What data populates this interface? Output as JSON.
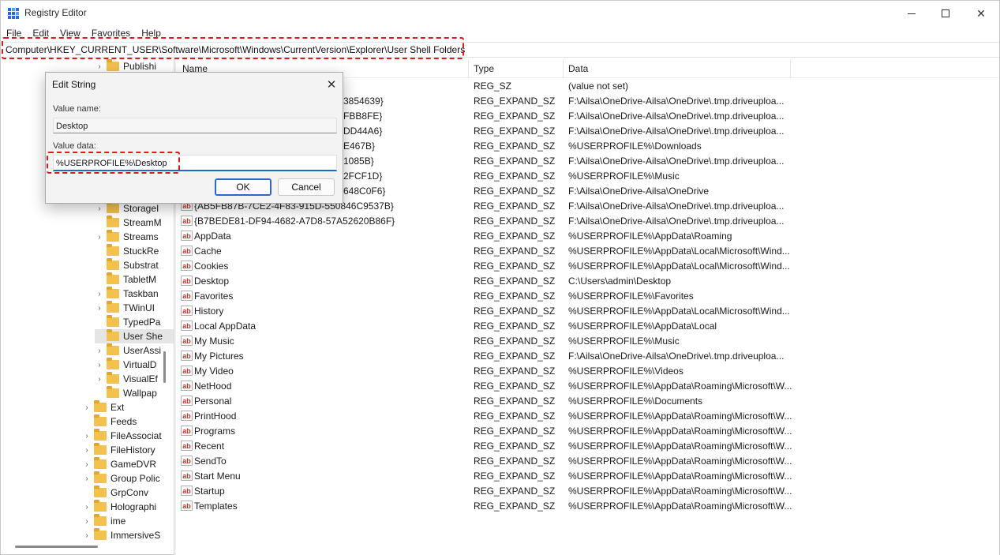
{
  "window": {
    "title": "Registry Editor",
    "controls": {
      "minimize": "minimize-icon",
      "maximize": "maximize-icon",
      "close": "close-icon"
    }
  },
  "menu": [
    "File",
    "Edit",
    "View",
    "Favorites",
    "Help"
  ],
  "address": "Computer\\HKEY_CURRENT_USER\\Software\\Microsoft\\Windows\\CurrentVersion\\Explorer\\User Shell Folders",
  "tree": {
    "items": [
      {
        "label": "Publishi",
        "expandable": true,
        "selected": false
      },
      {
        "label": "StorageI",
        "expandable": true,
        "selected": false
      },
      {
        "label": "StreamM",
        "expandable": false,
        "selected": false
      },
      {
        "label": "Streams",
        "expandable": true,
        "selected": false
      },
      {
        "label": "StuckRe",
        "expandable": false,
        "selected": false
      },
      {
        "label": "Substrat",
        "expandable": false,
        "selected": false
      },
      {
        "label": "TabletM",
        "expandable": false,
        "selected": false
      },
      {
        "label": "Taskban",
        "expandable": true,
        "selected": false
      },
      {
        "label": "TWinUI",
        "expandable": true,
        "selected": false
      },
      {
        "label": "TypedPa",
        "expandable": false,
        "selected": false
      },
      {
        "label": "User She",
        "expandable": false,
        "selected": true
      },
      {
        "label": "UserAssi",
        "expandable": true,
        "selected": false
      },
      {
        "label": "VirtualD",
        "expandable": true,
        "selected": false
      },
      {
        "label": "VisualEf",
        "expandable": true,
        "selected": false
      },
      {
        "label": "Wallpap",
        "expandable": false,
        "selected": false
      },
      {
        "label": "Ext",
        "expandable": true,
        "selected": false
      },
      {
        "label": "Feeds",
        "expandable": false,
        "selected": false
      },
      {
        "label": "FileAssociat",
        "expandable": true,
        "selected": false
      },
      {
        "label": "FileHistory",
        "expandable": true,
        "selected": false
      },
      {
        "label": "GameDVR",
        "expandable": true,
        "selected": false
      },
      {
        "label": "Group Polic",
        "expandable": true,
        "selected": false
      },
      {
        "label": "GrpConv",
        "expandable": false,
        "selected": false
      },
      {
        "label": "Holographi",
        "expandable": true,
        "selected": false
      },
      {
        "label": "ime",
        "expandable": true,
        "selected": false
      },
      {
        "label": "ImmersiveS",
        "expandable": true,
        "selected": false
      }
    ]
  },
  "list": {
    "columns": {
      "name": "Name",
      "type": "Type",
      "data": "Data"
    },
    "rows": [
      {
        "name": "",
        "type": "REG_SZ",
        "data": "(value not set)"
      },
      {
        "name": "3854639}",
        "type": "REG_EXPAND_SZ",
        "data": "F:\\Ailsa\\OneDrive-Ailsa\\OneDrive\\.tmp.driveuploa..."
      },
      {
        "name": "FBB8FE}",
        "type": "REG_EXPAND_SZ",
        "data": "F:\\Ailsa\\OneDrive-Ailsa\\OneDrive\\.tmp.driveuploa..."
      },
      {
        "name": "DD44A6}",
        "type": "REG_EXPAND_SZ",
        "data": "F:\\Ailsa\\OneDrive-Ailsa\\OneDrive\\.tmp.driveuploa..."
      },
      {
        "name": "E467B}",
        "type": "REG_EXPAND_SZ",
        "data": "%USERPROFILE%\\Downloads"
      },
      {
        "name": "1085B}",
        "type": "REG_EXPAND_SZ",
        "data": "F:\\Ailsa\\OneDrive-Ailsa\\OneDrive\\.tmp.driveuploa..."
      },
      {
        "name": "2FCF1D}",
        "type": "REG_EXPAND_SZ",
        "data": "%USERPROFILE%\\Music"
      },
      {
        "name": "648C0F6}",
        "type": "REG_EXPAND_SZ",
        "data": "F:\\Ailsa\\OneDrive-Ailsa\\OneDrive"
      },
      {
        "name": "{AB5FB87B-7CE2-4F83-915D-550846C9537B}",
        "type": "REG_EXPAND_SZ",
        "data": "F:\\Ailsa\\OneDrive-Ailsa\\OneDrive\\.tmp.driveuploa..."
      },
      {
        "name": "{B7BEDE81-DF94-4682-A7D8-57A52620B86F}",
        "type": "REG_EXPAND_SZ",
        "data": "F:\\Ailsa\\OneDrive-Ailsa\\OneDrive\\.tmp.driveuploa..."
      },
      {
        "name": "AppData",
        "type": "REG_EXPAND_SZ",
        "data": "%USERPROFILE%\\AppData\\Roaming"
      },
      {
        "name": "Cache",
        "type": "REG_EXPAND_SZ",
        "data": "%USERPROFILE%\\AppData\\Local\\Microsoft\\Wind..."
      },
      {
        "name": "Cookies",
        "type": "REG_EXPAND_SZ",
        "data": "%USERPROFILE%\\AppData\\Local\\Microsoft\\Wind..."
      },
      {
        "name": "Desktop",
        "type": "REG_EXPAND_SZ",
        "data": "C:\\Users\\admin\\Desktop"
      },
      {
        "name": "Favorites",
        "type": "REG_EXPAND_SZ",
        "data": "%USERPROFILE%\\Favorites"
      },
      {
        "name": "History",
        "type": "REG_EXPAND_SZ",
        "data": "%USERPROFILE%\\AppData\\Local\\Microsoft\\Wind..."
      },
      {
        "name": "Local AppData",
        "type": "REG_EXPAND_SZ",
        "data": "%USERPROFILE%\\AppData\\Local"
      },
      {
        "name": "My Music",
        "type": "REG_EXPAND_SZ",
        "data": "%USERPROFILE%\\Music"
      },
      {
        "name": "My Pictures",
        "type": "REG_EXPAND_SZ",
        "data": "F:\\Ailsa\\OneDrive-Ailsa\\OneDrive\\.tmp.driveuploa..."
      },
      {
        "name": "My Video",
        "type": "REG_EXPAND_SZ",
        "data": "%USERPROFILE%\\Videos"
      },
      {
        "name": "NetHood",
        "type": "REG_EXPAND_SZ",
        "data": "%USERPROFILE%\\AppData\\Roaming\\Microsoft\\W..."
      },
      {
        "name": "Personal",
        "type": "REG_EXPAND_SZ",
        "data": "%USERPROFILE%\\Documents"
      },
      {
        "name": "PrintHood",
        "type": "REG_EXPAND_SZ",
        "data": "%USERPROFILE%\\AppData\\Roaming\\Microsoft\\W..."
      },
      {
        "name": "Programs",
        "type": "REG_EXPAND_SZ",
        "data": "%USERPROFILE%\\AppData\\Roaming\\Microsoft\\W..."
      },
      {
        "name": "Recent",
        "type": "REG_EXPAND_SZ",
        "data": "%USERPROFILE%\\AppData\\Roaming\\Microsoft\\W..."
      },
      {
        "name": "SendTo",
        "type": "REG_EXPAND_SZ",
        "data": "%USERPROFILE%\\AppData\\Roaming\\Microsoft\\W..."
      },
      {
        "name": "Start Menu",
        "type": "REG_EXPAND_SZ",
        "data": "%USERPROFILE%\\AppData\\Roaming\\Microsoft\\W..."
      },
      {
        "name": "Startup",
        "type": "REG_EXPAND_SZ",
        "data": "%USERPROFILE%\\AppData\\Roaming\\Microsoft\\W..."
      },
      {
        "name": "Templates",
        "type": "REG_EXPAND_SZ",
        "data": "%USERPROFILE%\\AppData\\Roaming\\Microsoft\\W..."
      }
    ]
  },
  "dialog": {
    "title": "Edit String",
    "value_name_label": "Value name:",
    "value_name": "Desktop",
    "value_data_label": "Value data:",
    "value_data": "%USERPROFILE%\\Desktop",
    "ok_label": "OK",
    "cancel_label": "Cancel"
  },
  "colors": {
    "accent": "#1a6ad4",
    "highlight": "#e01a1a",
    "folder": "#f2c14e"
  }
}
